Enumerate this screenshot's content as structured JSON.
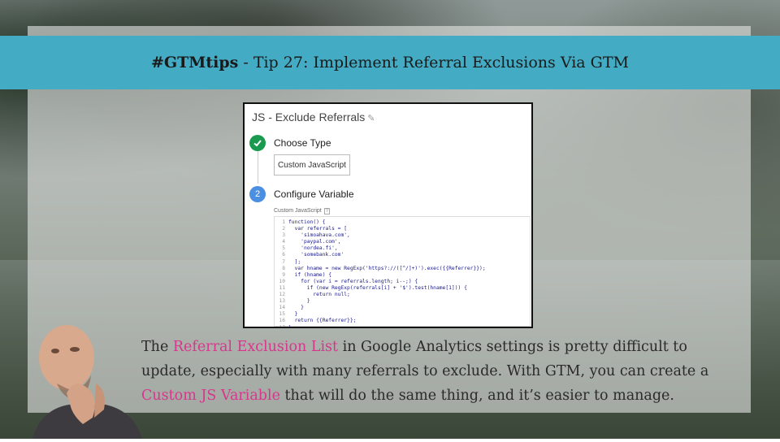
{
  "title": {
    "tag": "#GTMtips",
    "separator": " - ",
    "text": "Tip 27: Implement Referral Exclusions Via GTM"
  },
  "screenshot": {
    "header": "JS - Exclude Referrals",
    "step1_label": "Choose Type",
    "type_value": "Custom JavaScript",
    "step2_number": "2",
    "step2_label": "Configure Variable",
    "field_label": "Custom JavaScript",
    "field_help": "?",
    "code_lines": [
      {
        "n": "1",
        "t": "function() {"
      },
      {
        "n": "2",
        "t": "  var referrals = ["
      },
      {
        "n": "3",
        "t": "    'simoahava.com',"
      },
      {
        "n": "4",
        "t": "    'paypal.com',"
      },
      {
        "n": "5",
        "t": "    'nordea.fi',"
      },
      {
        "n": "6",
        "t": "    'somebank.com'"
      },
      {
        "n": "7",
        "t": "  ];"
      },
      {
        "n": "8",
        "t": "  var hname = new RegExp('https?://([^/]+)').exec({{Referrer}});"
      },
      {
        "n": "9",
        "t": "  if (hname) {"
      },
      {
        "n": "10",
        "t": "    for (var i = referrals.length; i--;) {"
      },
      {
        "n": "11",
        "t": "      if (new RegExp(referrals[i] + '$').test(hname[1])) {"
      },
      {
        "n": "12",
        "t": "        return null;"
      },
      {
        "n": "13",
        "t": "      }"
      },
      {
        "n": "14",
        "t": "    }"
      },
      {
        "n": "15",
        "t": "  }"
      },
      {
        "n": "16",
        "t": "  return {{Referrer}};"
      },
      {
        "n": "17",
        "t": "}"
      }
    ]
  },
  "caption": {
    "part1": "The ",
    "highlight1": "Referral Exclusion List",
    "part2": " in Google Analytics settings is pretty difficult to update, especially with many referrals to exclude. With GTM, you can create a ",
    "highlight2": "Custom JS Variable",
    "part3": " that will do the same thing, and it’s easier to manage."
  },
  "colors": {
    "title_bar": "#43abc3",
    "highlight": "#d6378c",
    "step_done": "#1a9a4f",
    "step_number": "#4a8fe0"
  },
  "icons": {
    "step1": "checkmark-icon",
    "header_edit": "pencil-icon"
  }
}
